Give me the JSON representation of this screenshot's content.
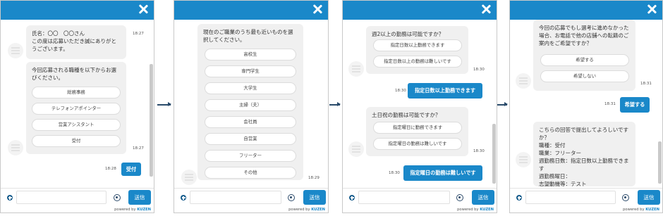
{
  "panel1": {
    "bubble1_text": "氏名：〇〇　〇〇さん\nこの度は応募いただき誠にありがとうございます。",
    "bubble1_time": "18:27",
    "bubble2_text": "今回応募される職種を以下からお選びください。",
    "options": [
      "総務事務",
      "テレフォンアポインター",
      "営業アシスタント",
      "受付"
    ],
    "bubble2_time": "18:27",
    "user_reply": "受付",
    "user_reply_time": "18:28"
  },
  "panel2": {
    "bubble_text": "現在のご職業のうち最も近いものを選択してください。",
    "options": [
      "高校生",
      "専門学生",
      "大学生",
      "主婦（夫）",
      "会社員",
      "自営業",
      "フリーター",
      "その他"
    ],
    "time": "18:29"
  },
  "panel3": {
    "bubble1_text": "週2以上の勤務は可能ですか？",
    "bubble1_options": [
      "指定日数以上勤務できます",
      "指定日数以上の勤務は難しいです"
    ],
    "bubble1_time": "18:30",
    "user_reply1": "指定日数以上勤務できます",
    "user_reply1_time": "18:30",
    "bubble2_text": "土日祝の勤務は可能ですか？",
    "bubble2_options": [
      "指定曜日に勤務できます",
      "指定曜日の勤務は難しいです"
    ],
    "bubble2_time": "18:30",
    "user_reply2": "指定曜日の勤務は難しいです",
    "user_reply2_time": "18:30"
  },
  "panel4": {
    "bubble1_text": "今回の応募でもし選考に進めなかった場合、お電話で他の店舗への転籍のご案内をご希望ですか？",
    "options": [
      "希望する",
      "希望しない"
    ],
    "bubble1_time": "18:31",
    "user_reply": "希望する",
    "user_reply_time": "18:31",
    "bubble2_text": "こちらの回答で提出してよろしいですか？\n職種：受付\n職業：フリーター\n週勤務日数：指定日数以上勤務できます\n週勤務曜日：\n志望動機等：テスト"
  },
  "input_bar": {
    "send_label": "送信",
    "powered_by": "powered by",
    "brand": "KUZEN"
  },
  "colors": {
    "accent": "#1a88c9",
    "bubble_bg": "#f0f0f0"
  },
  "icons": [
    "close-icon",
    "plus-icon",
    "target-icon",
    "arrow-right-icon"
  ]
}
